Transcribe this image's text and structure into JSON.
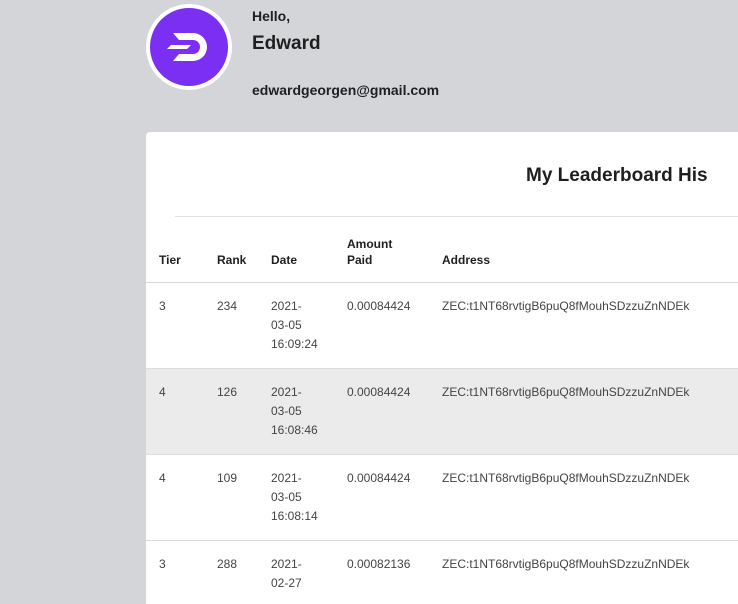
{
  "profile": {
    "greeting": "Hello,",
    "name": "Edward",
    "email": "edwardgeorgen@gmail.com",
    "brand_color": "#7b2ff2"
  },
  "leaderboard": {
    "title": "My Leaderboard His",
    "columns": {
      "tier": "Tier",
      "rank": "Rank",
      "date": "Date",
      "amount_line1": "Amount",
      "amount_line2": "Paid",
      "address": "Address"
    },
    "rows": [
      {
        "tier": "3",
        "rank": "234",
        "date_1": "2021-",
        "date_2": "03-05",
        "date_3": "16:09:24",
        "amount": "0.00084424",
        "address": "ZEC:t1NT68rvtigB6puQ8fMouhSDzzuZnNDEk"
      },
      {
        "tier": "4",
        "rank": "126",
        "date_1": "2021-",
        "date_2": "03-05",
        "date_3": "16:08:46",
        "amount": "0.00084424",
        "address": "ZEC:t1NT68rvtigB6puQ8fMouhSDzzuZnNDEk"
      },
      {
        "tier": "4",
        "rank": "109",
        "date_1": "2021-",
        "date_2": "03-05",
        "date_3": "16:08:14",
        "amount": "0.00084424",
        "address": "ZEC:t1NT68rvtigB6puQ8fMouhSDzzuZnNDEk"
      },
      {
        "tier": "3",
        "rank": "288",
        "date_1": "2021-",
        "date_2": "02-27",
        "date_3": "",
        "amount": "0.00082136",
        "address": "ZEC:t1NT68rvtigB6puQ8fMouhSDzzuZnNDEk"
      }
    ]
  }
}
